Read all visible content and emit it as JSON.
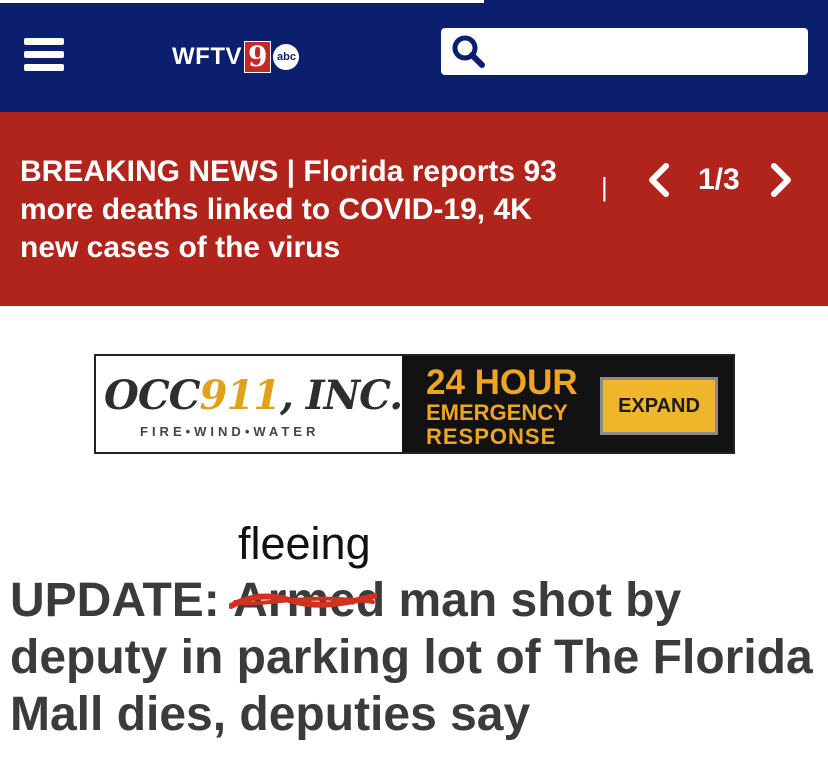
{
  "header": {
    "menu_icon": "hamburger-menu-icon",
    "logo_text": "WFTV",
    "logo_nine": "9",
    "logo_abc": "abc",
    "search_icon": "search-icon",
    "search_placeholder": "",
    "bg_color": "#0b1f6e"
  },
  "breaking": {
    "text": "BREAKING NEWS | Florida reports 93 more deaths linked to COVID-19, 4K new cases of the virus",
    "separator": "|",
    "page_indicator": "1/3",
    "prev_icon": "chevron-left-icon",
    "next_icon": "chevron-right-icon",
    "bg_color": "#b0241b"
  },
  "ad": {
    "brand_prefix": "OCC",
    "brand_number": "911",
    "brand_suffix": ", INC.",
    "tagline": "FIRE•WIND•WATER",
    "line1": "24 HOUR",
    "line2": "EMERGENCY",
    "line3": "RESPONSE",
    "expand_label": "EXPAND",
    "accent_color": "#f0a522"
  },
  "article": {
    "handwritten_insert": "fleeing",
    "headline_prefix": "UPDATE: ",
    "struck_word": "Armed",
    "headline_rest": " man shot by deputy in parking lot of The Florida Mall dies, deputies say",
    "strike_color": "#d0321f"
  }
}
